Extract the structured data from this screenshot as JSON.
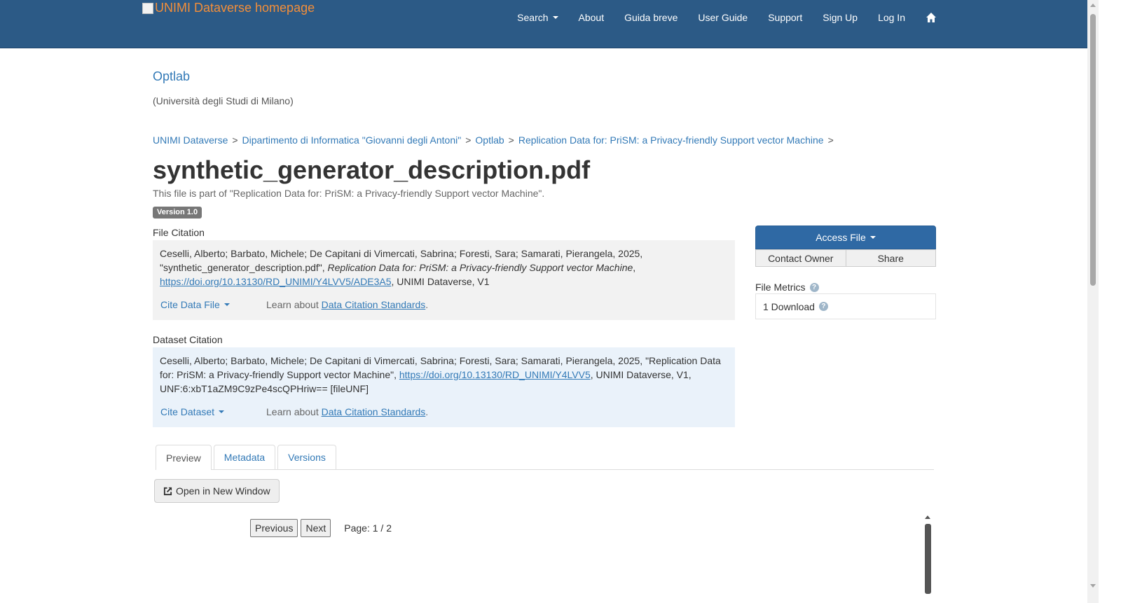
{
  "header": {
    "logo_alt": "UNIMI Dataverse homepage",
    "nav": [
      "Search",
      "About",
      "Guida breve",
      "User Guide",
      "Support",
      "Sign Up",
      "Log In"
    ],
    "home_icon": "home-icon"
  },
  "dataverse": {
    "name": "Optlab",
    "affiliation": "(Università degli Studi di Milano)"
  },
  "breadcrumb": [
    "UNIMI Dataverse",
    "Dipartimento di Informatica \"Giovanni degli Antoni\"",
    "Optlab",
    "Replication Data for: PriSM: a Privacy-friendly Support vector Machine"
  ],
  "breadcrumb_separator": ">",
  "file": {
    "title": "synthetic_generator_description.pdf",
    "part_of": "This file is part of \"Replication Data for: PriSM: a Privacy-friendly Support vector Machine\".",
    "version_badge": "Version 1.0"
  },
  "file_citation": {
    "label": "File Citation",
    "text_1": "Ceselli, Alberto; Barbato, Michele; De Capitani di Vimercati, Sabrina; Foresti, Sara; Samarati, Pierangela, 2025, \"synthetic_generator_description.pdf\", ",
    "italic": "Replication Data for: PriSM: a Privacy-friendly Support vector Machine",
    "text_2": ",",
    "link": "https://doi.org/10.13130/RD_UNIMI/Y4LVV5/ADE3A5",
    "text_3": ", UNIMI Dataverse, V1",
    "cite_button": "Cite Data File",
    "learn_prefix": "Learn about ",
    "learn_link": "Data Citation Standards",
    "learn_suffix": "."
  },
  "dataset_citation": {
    "label": "Dataset Citation",
    "text_1": "Ceselli, Alberto; Barbato, Michele; De Capitani di Vimercati, Sabrina; Foresti, Sara; Samarati, Pierangela, 2025, \"Replication Data for: PriSM: a Privacy-friendly Support vector Machine\", ",
    "link": "https://doi.org/10.13130/RD_UNIMI/Y4LVV5",
    "text_2": ", UNIMI Dataverse, V1, UNF:6:xbT1aZM9C9zPe4scQPHriw== [fileUNF]",
    "cite_button": "Cite Dataset",
    "learn_prefix": "Learn about ",
    "learn_link": "Data Citation Standards",
    "learn_suffix": "."
  },
  "actions": {
    "access_file": "Access File",
    "contact_owner": "Contact Owner",
    "share": "Share"
  },
  "metrics": {
    "label": "File Metrics",
    "downloads": "1 Download"
  },
  "tabs": [
    "Preview",
    "Metadata",
    "Versions"
  ],
  "preview": {
    "open_window": "Open in New Window",
    "previous": "Previous",
    "next": "Next",
    "page_info": "Page: 1 / 2"
  },
  "colors": {
    "navbar": "#2c5a86",
    "link": "#337ab7",
    "logo_text": "#f28e3a",
    "access_button": "#2f69a4"
  }
}
